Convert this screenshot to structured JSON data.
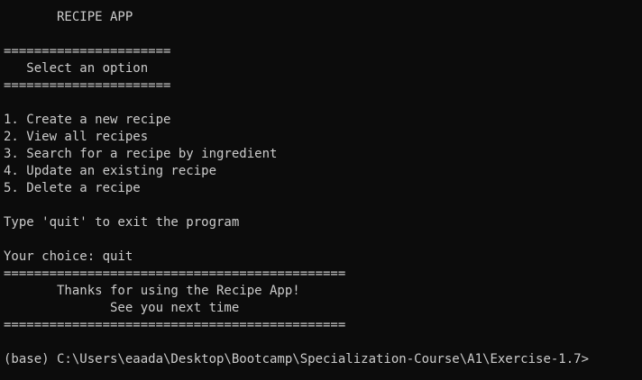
{
  "terminal": {
    "lines": [
      "       RECIPE APP",
      "",
      "======================",
      "   Select an option",
      "======================",
      "",
      "1. Create a new recipe",
      "2. View all recipes",
      "3. Search for a recipe by ingredient",
      "4. Update an existing recipe",
      "5. Delete a recipe",
      "",
      "Type 'quit' to exit the program",
      "",
      "Your choice: quit",
      "=============================================",
      "       Thanks for using the Recipe App!",
      "              See you next time",
      "=============================================",
      "",
      "(base) C:\\Users\\eaada\\Desktop\\Bootcamp\\Specialization-Course\\A1\\Exercise-1.7>"
    ]
  }
}
